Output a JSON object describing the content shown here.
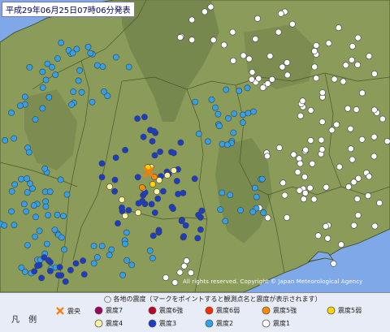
{
  "title": "平成29年06月25日07時06分発表",
  "copyright": "All rights reserved. Copyright © Japan Meteorological Agency",
  "legend": {
    "note": "◯ 各地の震度（マークをポイントすると観測点名と震度が表示されます）",
    "heading": "凡 例",
    "epicenter_label": "震央",
    "items": [
      {
        "label": "震度7",
        "color": "#a0005a"
      },
      {
        "label": "震度6強",
        "color": "#c00022"
      },
      {
        "label": "震度6弱",
        "color": "#ff2a00"
      },
      {
        "label": "震度5強",
        "color": "#ff8c00"
      },
      {
        "label": "震度5弱",
        "color": "#ffd400"
      },
      {
        "label": "震度4",
        "color": "#fff2a8"
      },
      {
        "label": "震度3",
        "color": "#1a3cc8"
      },
      {
        "label": "震度2",
        "color": "#33a0e8"
      },
      {
        "label": "震度1",
        "color": "#ffffff"
      }
    ]
  },
  "colors": {
    "land": "#8a9b5a",
    "mountain": "#6f8048",
    "coast": "#3b4a24",
    "sea": "#7ea8e8",
    "epicenter": "#ff7a00"
  }
}
